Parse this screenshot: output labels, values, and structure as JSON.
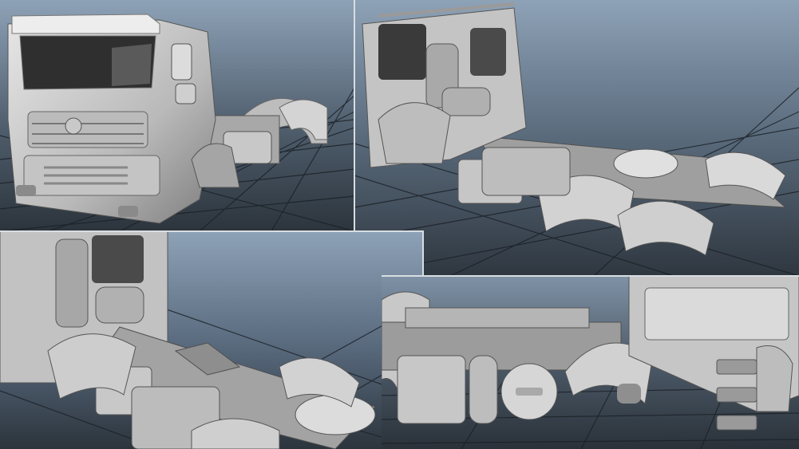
{
  "scene": {
    "description_label": "",
    "background_gradient": [
      "#8ea2b7",
      "#2c343c"
    ],
    "grid_color": "#1a1f25",
    "model_color": "#cfcfcf",
    "model_shadow": "#5e5e5e",
    "panels": [
      {
        "id": "front-view"
      },
      {
        "id": "rear-three-quarter-view"
      },
      {
        "id": "chassis-detail-view"
      },
      {
        "id": "side-underside-view"
      }
    ]
  }
}
